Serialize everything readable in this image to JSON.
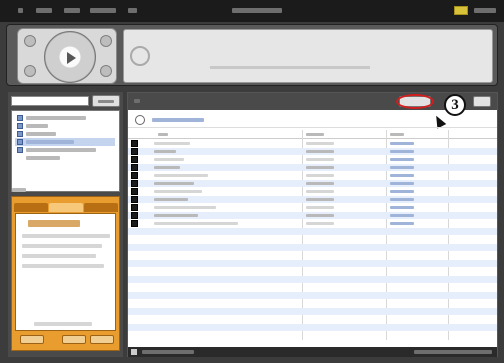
{
  "callout": {
    "number": "3"
  },
  "colors": {
    "window_frame": "#3c3c3c",
    "title_bar": "#1b1b1b",
    "highlight_ring": "#d21e1e",
    "mini_panel": "#e89d2e",
    "selected_row": "#c4d4ee",
    "alternate_row": "#e6eefb"
  },
  "icons": [
    "app-logo-icon",
    "play-icon",
    "previous-icon",
    "next-icon",
    "stop-icon",
    "volume-icon",
    "folder-icon",
    "playlist-icon",
    "row-checkbox-icon",
    "cursor-pointer-icon"
  ]
}
